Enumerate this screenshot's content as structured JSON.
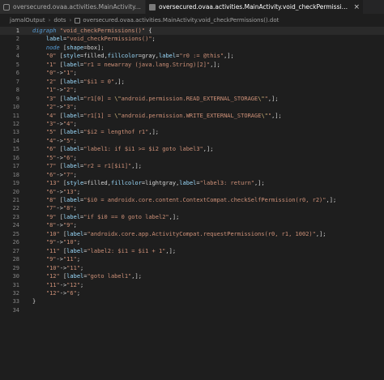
{
  "tabs": [
    {
      "label": "oversecured.ovaa.activities.MainActivity.grimple",
      "icon": "file-icon",
      "active": false
    },
    {
      "label": "oversecured.ovaa.activities.MainActivity.void_checkPermissions().dot",
      "icon": "document-icon",
      "active": true
    }
  ],
  "tab_close": "×",
  "breadcrumb": [
    "jamalOutput",
    "dots",
    "oversecured.ovaa.activities.MainActivity.void_checkPermissions().dot"
  ],
  "breadcrumb_separator": "›",
  "current_line": 1,
  "lines": [
    "digraph \"void_checkPermissions()\" {",
    "    label=\"void_checkPermissions()\";",
    "    node [shape=box];",
    "    \"0\" [style=filled,fillcolor=gray,label=\"r0 := @this\",];",
    "    \"1\" [label=\"r1 = newarray (java.lang.String)[2]\",];",
    "    \"0\"->\"1\";",
    "    \"2\" [label=\"$i1 = 0\",];",
    "    \"1\"->\"2\";",
    "    \"3\" [label=\"r1[0] = \\\"android.permission.READ_EXTERNAL_STORAGE\\\"\",];",
    "    \"2\"->\"3\";",
    "    \"4\" [label=\"r1[1] = \\\"android.permission.WRITE_EXTERNAL_STORAGE\\\"\",];",
    "    \"3\"->\"4\";",
    "    \"5\" [label=\"$i2 = lengthof r1\",];",
    "    \"4\"->\"5\";",
    "    \"6\" [label=\"label1: if $i1 >= $i2 goto label3\",];",
    "    \"5\"->\"6\";",
    "    \"7\" [label=\"r2 = r1[$i1]\",];",
    "    \"6\"->\"7\";",
    "    \"13\" [style=filled,fillcolor=lightgray,label=\"label3: return\",];",
    "    \"6\"->\"13\";",
    "    \"8\" [label=\"$i0 = androidx.core.content.ContextCompat.checkSelfPermission(r0, r2)\",];",
    "    \"7\"->\"8\";",
    "    \"9\" [label=\"if $i0 == 0 goto label2\",];",
    "    \"8\"->\"9\";",
    "    \"10\" [label=\"androidx.core.app.ActivityCompat.requestPermissions(r0, r1, 1002)\",];",
    "    \"9\"->\"10\";",
    "    \"11\" [label=\"label2: $i1 = $i1 + 1\",];",
    "    \"9\"->\"11\";",
    "    \"10\"->\"11\";",
    "    \"12\" [label=\"goto label1\",];",
    "    \"11\"->\"12\";",
    "    \"12\"->\"6\";",
    "}",
    ""
  ],
  "colors": {
    "background": "#1e1e1e",
    "keyword": "#569cd6",
    "string": "#ce9178",
    "attribute": "#9cdcfe",
    "line_number": "#858585"
  }
}
